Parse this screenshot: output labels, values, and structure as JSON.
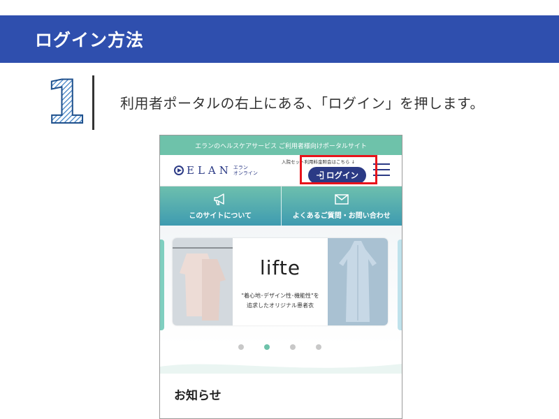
{
  "header": {
    "title": "ログイン方法"
  },
  "step": {
    "number": "1",
    "instruction": "利用者ポータルの右上にある、「ログイン」を押します。"
  },
  "phone": {
    "top_banner": "エランのヘルスケアサービス ご利用者様向けポータルサイト",
    "logo": {
      "text": "ELAN",
      "sub_line1": "エラン",
      "sub_line2": "オンライン"
    },
    "header_notice": "入院セット利用料金照会はこちら ↓",
    "login_button": {
      "label": "ログイン",
      "icon": "login-icon"
    },
    "menu_icon": "hamburger-menu-icon",
    "highlight_color": "#e8141b",
    "nav": [
      {
        "icon": "megaphone-icon",
        "label": "このサイトについて"
      },
      {
        "icon": "mail-icon",
        "label": "よくあるご質問・お問い合わせ"
      }
    ],
    "slide": {
      "brand": "lifte",
      "caption_line1": "\"着心地･デザイン性･機能性\"を",
      "caption_line2": "追求したオリジナル患者衣"
    },
    "carousel": {
      "slide_count": 4,
      "active_index": 1
    },
    "news_title": "お知らせ"
  },
  "colors": {
    "header_blue": "#2f4fae",
    "brand_navy": "#2b3a85",
    "teal": "#6ec2aa"
  }
}
